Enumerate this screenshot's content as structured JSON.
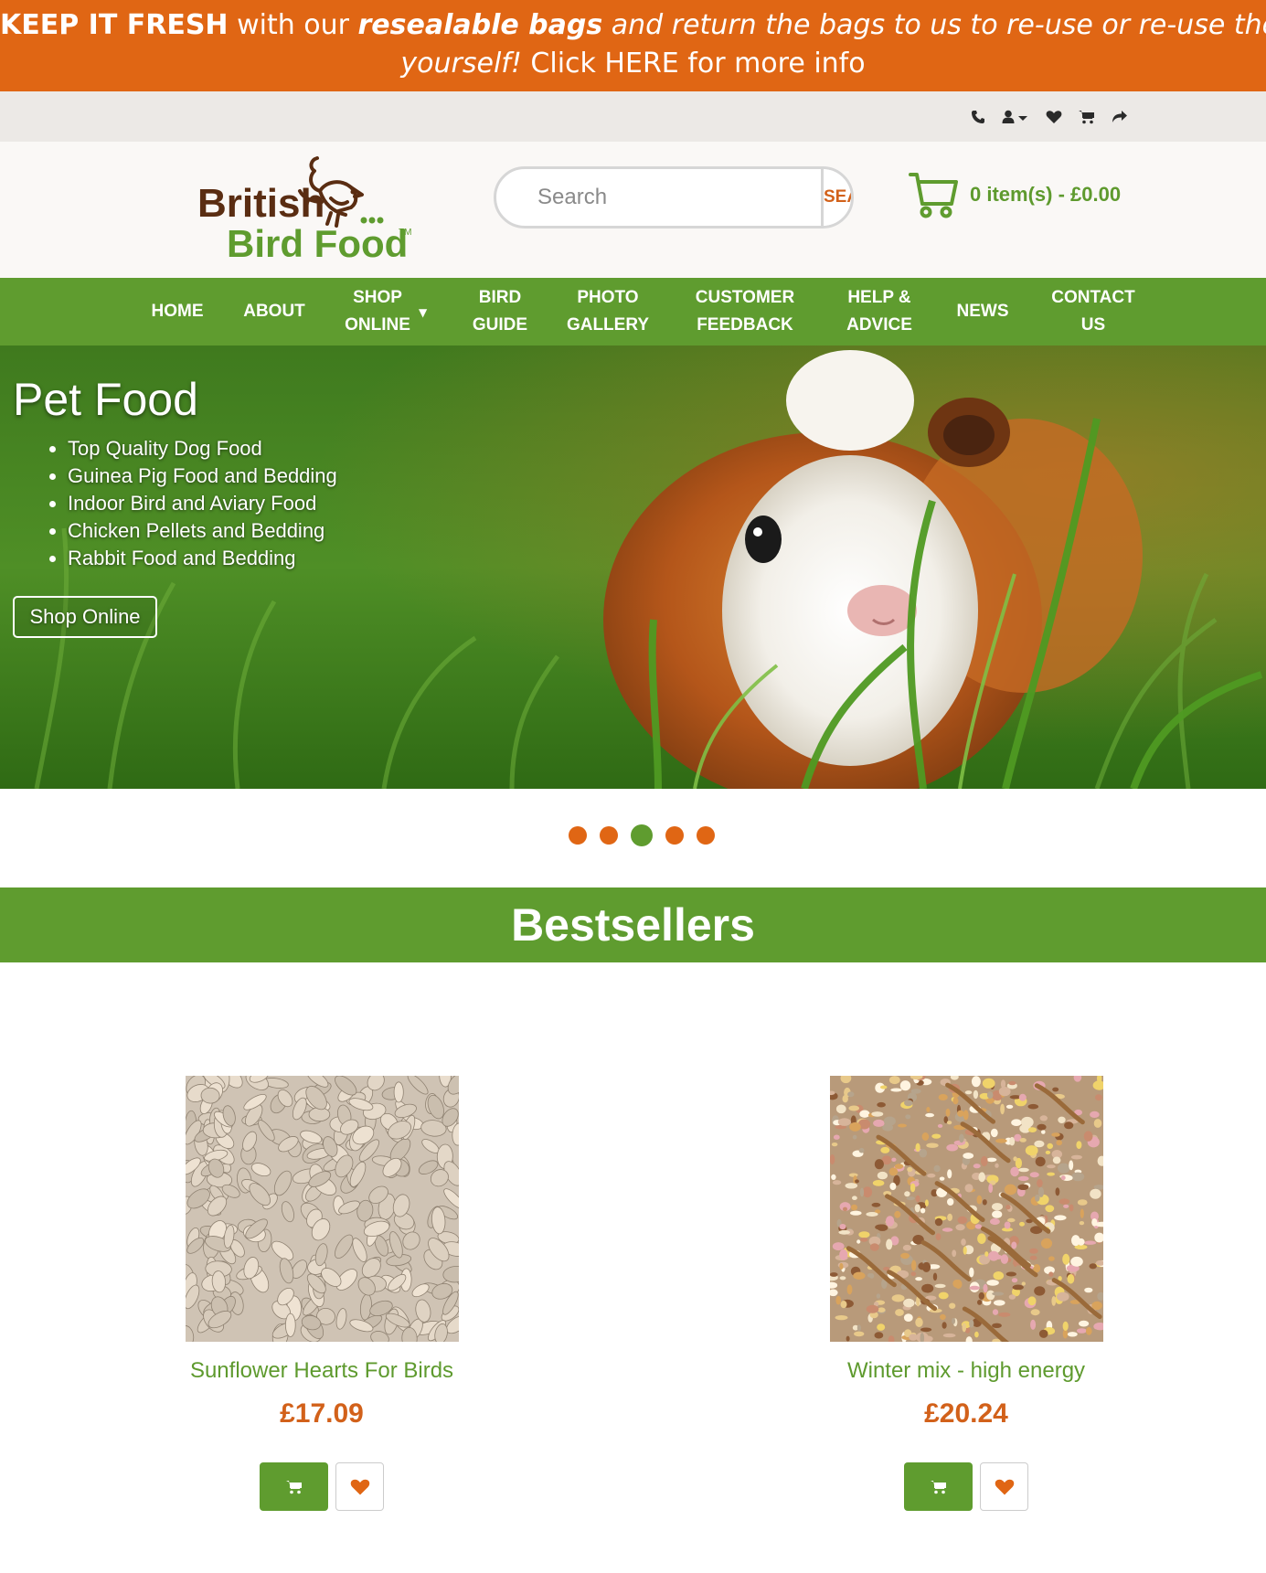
{
  "promo": {
    "keep": "KEEP IT FRESH",
    "with": " with our ",
    "resealable": "resealable bags",
    "rest1": " and return the bags to us to re-use or re-use them",
    "yourself": "yourself!",
    "rest2": " Click HERE for more info"
  },
  "utility": {
    "icons": [
      "phone-icon",
      "user-icon",
      "heart-icon",
      "cart-icon",
      "share-icon"
    ]
  },
  "logo": {
    "line1": "British",
    "line2": "Bird Food",
    "tm": "TM"
  },
  "search": {
    "placeholder": "Search",
    "button": "SEARCH"
  },
  "cart": {
    "summary": "0 item(s) - £0.00"
  },
  "nav": [
    {
      "l1": "HOME",
      "l2": ""
    },
    {
      "l1": "ABOUT",
      "l2": ""
    },
    {
      "l1": "SHOP",
      "l2": "ONLINE"
    },
    {
      "l1": "BIRD",
      "l2": "GUIDE"
    },
    {
      "l1": "PHOTO",
      "l2": "GALLERY"
    },
    {
      "l1": "CUSTOMER",
      "l2": "FEEDBACK"
    },
    {
      "l1": "HELP &",
      "l2": "ADVICE"
    },
    {
      "l1": "NEWS",
      "l2": ""
    },
    {
      "l1": "CONTACT",
      "l2": "US"
    }
  ],
  "hero": {
    "title": "Pet Food",
    "items": [
      "Top Quality Dog Food",
      "Guinea Pig Food and Bedding",
      "Indoor Bird and Aviary Food",
      "Chicken Pellets and Bedding",
      "Rabbit Food and Bedding"
    ],
    "button": "Shop Online"
  },
  "carousel": {
    "count": 5,
    "active_index": 2
  },
  "bestsellers": {
    "title": "Bestsellers",
    "products": [
      {
        "name": "Sunflower Hearts For Birds",
        "price": "£17.09"
      },
      {
        "name": "Winter mix - high energy",
        "price": "£20.24"
      }
    ]
  },
  "colors": {
    "orange": "#e06614",
    "green": "#5f9c2f",
    "brown": "#5a2d12"
  }
}
